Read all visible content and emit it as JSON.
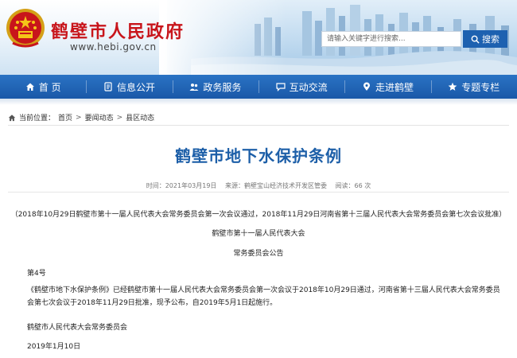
{
  "header": {
    "site_title": "鹤壁市人民政府",
    "site_url": "www.hebi.gov.cn",
    "search_placeholder": "请输入关键字进行搜索...",
    "search_button": "搜索"
  },
  "nav": {
    "items": [
      {
        "label": "首 页",
        "icon": "home-icon"
      },
      {
        "label": "信息公开",
        "icon": "document-icon"
      },
      {
        "label": "政务服务",
        "icon": "people-icon"
      },
      {
        "label": "互动交流",
        "icon": "chat-icon"
      },
      {
        "label": "走进鹤壁",
        "icon": "pin-icon"
      },
      {
        "label": "专题专栏",
        "icon": "star-icon"
      }
    ]
  },
  "breadcrumb": {
    "label": "当前位置：",
    "items": [
      "首页",
      "要闻动态",
      "县区动态"
    ],
    "separator": ">"
  },
  "article": {
    "title": "鹤壁市地下水保护条例",
    "meta": {
      "time": "时间：2021年03月19日",
      "source": "来源：鹤壁宝山经济技术开发区管委",
      "views": "阅读：66 次"
    },
    "p1": "（2018年10月29日鹤壁市第十一届人民代表大会常务委员会第一次会议通过，2018年11月29日河南省第十三届人民代表大会常务委员会第七次会议批准）",
    "p2": "鹤壁市第十一届人民代表大会",
    "p3": "常务委员会公告",
    "p4": "第4号",
    "p5": "《鹤壁市地下水保护条例》已经鹤壁市第十一届人民代表大会常务委员会第一次会议于2018年10月29日通过，河南省第十三届人民代表大会常务委员会第七次会议于2018年11月29日批准，现予公布，自2019年5月1日起施行。",
    "p6": "鹤壁市人民代表大会常务委员会",
    "p7": "2019年1月10日"
  },
  "colors": {
    "brand_red": "#c8151b",
    "nav_blue": "#1d61b0",
    "title_blue": "#1d5fa8"
  }
}
